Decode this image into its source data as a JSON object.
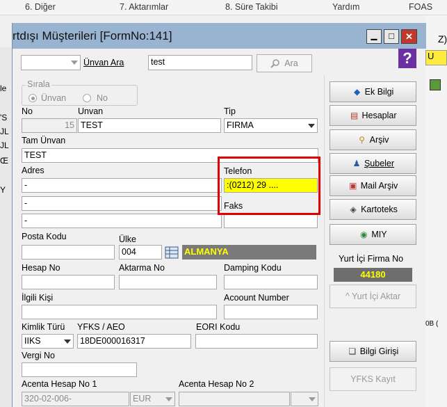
{
  "menubar": {
    "items": [
      "6. Diğer",
      "7. Aktarımlar",
      "8. Süre Takibi",
      "Yardım",
      "FOAS"
    ]
  },
  "window": {
    "title": "rtdışı Müşterileri [FormNo:141]",
    "min": "▁",
    "max": "□",
    "close": "✕"
  },
  "behind": {
    "right_edge_text": "Z)",
    "u_letter": "U",
    "side_letters": [
      "le",
      "'S",
      "JL",
      "JL",
      "Œ",
      "Y"
    ],
    "right_far": "0B ("
  },
  "search": {
    "unvan_ara_label": "Ünvan Ara",
    "value": "test",
    "ara_button": "Ara"
  },
  "sirala": {
    "legend": "Sırala",
    "opt1": "Ünvan",
    "opt2": "No"
  },
  "form": {
    "no_label": "No",
    "no_value": "15",
    "unvan_label": "Unvan",
    "unvan_value": "TEST",
    "tip_label": "Tip",
    "tip_value": "FIRMA",
    "tam_unvan_label": "Tam Ünvan",
    "tam_unvan_value": "TEST",
    "adres_label": "Adres",
    "adres1": "-",
    "adres2": "-",
    "adres3": "-",
    "telefon_label": "Telefon",
    "telefon_value": ":(0212) 29 ....",
    "faks_label": "Faks",
    "posta_kodu_label": "Posta Kodu",
    "ulke_label": "Ülke",
    "ulke_code": "004",
    "ulke_name": "ALMANYA",
    "hesap_no_label": "Hesap No",
    "aktarma_no_label": "Aktarma No",
    "damping_label": "Damping Kodu",
    "ilgili_label": "İlgili Kişi",
    "account_label": "Acoount Number",
    "kimlik_label": "Kimlik Türü",
    "kimlik_value": "IIKS",
    "yfks_label": "YFKS / AEO",
    "yfks_value": "18DE000016317",
    "eori_label": "EORI Kodu",
    "vergi_label": "Vergi No",
    "acenta1_label": "Acenta Hesap No 1",
    "acenta1_value": "320-02-006-",
    "acenta1_cur": "EUR",
    "acenta2_label": "Acenta Hesap No 2"
  },
  "buttons": {
    "ek_bilgi": "Ek Bilgi",
    "hesaplar": "Hesaplar",
    "arsiv": "Arşiv",
    "subeler": "Şubeler",
    "mail_arsiv": "Mail Arşiv",
    "kartoteks": "Kartoteks",
    "miy": "MIY",
    "yurt_ici_label": "Yurt İçi Firma No",
    "yurt_ici_value": "44180",
    "yurt_ici_aktar": "^ Yurt İçi Aktar",
    "bilgi_girisi": "Bilgi Girişi",
    "yfks_kayit": "YFKS Kayıt"
  },
  "colors": {
    "title_bg": "#99b4d1",
    "highlight": "#ffff00",
    "country_bg": "#7a7a7a",
    "country_text": "#ffff00",
    "red_box": "#e00000",
    "firma_no_bg": "#6e6e6e"
  }
}
